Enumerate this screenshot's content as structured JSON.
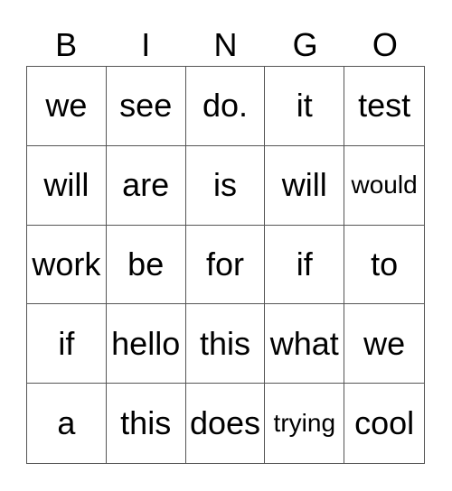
{
  "header": [
    "B",
    "I",
    "N",
    "G",
    "O"
  ],
  "rows": [
    [
      "we",
      "see",
      "do.",
      "it",
      "test"
    ],
    [
      "will",
      "are",
      "is",
      "will",
      "would"
    ],
    [
      "work",
      "be",
      "for",
      "if",
      "to"
    ],
    [
      "if",
      "hello",
      "this",
      "what",
      "we"
    ],
    [
      "a",
      "this",
      "does",
      "trying",
      "cool"
    ]
  ]
}
